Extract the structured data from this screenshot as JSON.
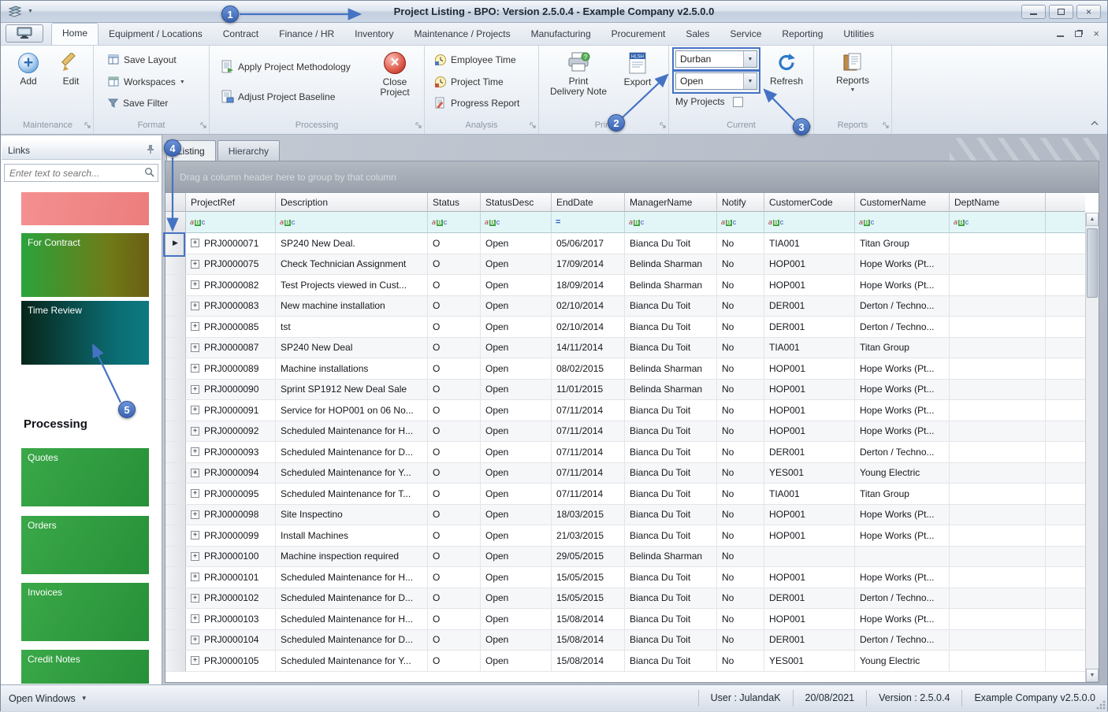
{
  "titlebar": {
    "screen_title": "Project Listing",
    "app_title": " - BPO: Version 2.5.0.4 - Example Company v2.5.0.0"
  },
  "icons": {
    "close": "×",
    "dropdown_caret": "▼",
    "scroll_up": "▲",
    "scroll_down": "▼",
    "expand_plus": "+",
    "row_indicator": "▶",
    "filter_abc": "aBc",
    "filter_equals": "=",
    "export_badge": "HLSH"
  },
  "ribbon": {
    "active_tab": "Home",
    "tabs": [
      "Home",
      "Equipment / Locations",
      "Contract",
      "Finance / HR",
      "Inventory",
      "Maintenance / Projects",
      "Manufacturing",
      "Procurement",
      "Sales",
      "Service",
      "Reporting",
      "Utilities"
    ],
    "maintenance": {
      "label": "Maintenance",
      "add": "Add",
      "edit": "Edit"
    },
    "format": {
      "label": "Format",
      "save_layout": "Save Layout",
      "workspaces": "Workspaces",
      "save_filter": "Save Filter"
    },
    "processing": {
      "label": "Processing",
      "apply": "Apply Project Methodology",
      "adjust": "Adjust Project Baseline",
      "close_line1": "Close",
      "close_line2": "Project"
    },
    "analysis": {
      "label": "Analysis",
      "employee_time": "Employee Time",
      "project_time": "Project Time",
      "progress_report": "Progress Report"
    },
    "print": {
      "label": "Print",
      "delivery_line1": "Print",
      "delivery_line2": "Delivery Note",
      "export": "Export"
    },
    "current": {
      "label": "Current",
      "site": "Durban",
      "status": "Open",
      "my_projects": "My Projects",
      "refresh": "Refresh"
    },
    "reports": {
      "label": "Reports",
      "button": "Reports"
    }
  },
  "sidebar": {
    "header": "Links",
    "search_placeholder": "Enter text to search...",
    "links": [
      {
        "label": ""
      },
      {
        "label": "For Contract"
      },
      {
        "label": "Time Review"
      }
    ],
    "section_header": "Processing",
    "processing_links": [
      "Quotes",
      "Orders",
      "Invoices",
      "Credit Notes"
    ]
  },
  "workspace": {
    "active_tab": "Listing",
    "tabs": [
      "Listing",
      "Hierarchy"
    ],
    "group_panel_hint": "Drag a column header here to group by that column"
  },
  "grid": {
    "columns": [
      "ProjectRef",
      "Description",
      "Status",
      "StatusDesc",
      "EndDate",
      "ManagerName",
      "Notify",
      "CustomerCode",
      "CustomerName",
      "DeptName"
    ],
    "filter_types": [
      "abc",
      "abc",
      "abc",
      "abc",
      "eq",
      "abc",
      "abc",
      "abc",
      "abc",
      "abc"
    ],
    "rows": [
      [
        "PRJ0000071",
        "SP240 New Deal.",
        "O",
        "Open",
        "05/06/2017",
        "Bianca Du Toit",
        "No",
        "TIA001",
        "Titan Group",
        ""
      ],
      [
        "PRJ0000075",
        "Check Technician Assignment",
        "O",
        "Open",
        "17/09/2014",
        "Belinda Sharman",
        "No",
        "HOP001",
        "Hope Works (Pt...",
        ""
      ],
      [
        "PRJ0000082",
        "Test Projects viewed in Cust...",
        "O",
        "Open",
        "18/09/2014",
        "Belinda Sharman",
        "No",
        "HOP001",
        "Hope Works (Pt...",
        ""
      ],
      [
        "PRJ0000083",
        "New machine installation",
        "O",
        "Open",
        "02/10/2014",
        "Bianca Du Toit",
        "No",
        "DER001",
        "Derton / Techno...",
        ""
      ],
      [
        "PRJ0000085",
        "tst",
        "O",
        "Open",
        "02/10/2014",
        "Bianca Du Toit",
        "No",
        "DER001",
        "Derton / Techno...",
        ""
      ],
      [
        "PRJ0000087",
        "SP240 New Deal",
        "O",
        "Open",
        "14/11/2014",
        "Bianca Du Toit",
        "No",
        "TIA001",
        "Titan Group",
        ""
      ],
      [
        "PRJ0000089",
        "Machine installations",
        "O",
        "Open",
        "08/02/2015",
        "Belinda Sharman",
        "No",
        "HOP001",
        "Hope Works (Pt...",
        ""
      ],
      [
        "PRJ0000090",
        "Sprint SP1912 New Deal Sale",
        "O",
        "Open",
        "11/01/2015",
        "Belinda Sharman",
        "No",
        "HOP001",
        "Hope Works (Pt...",
        ""
      ],
      [
        "PRJ0000091",
        "Service for HOP001 on 06 No...",
        "O",
        "Open",
        "07/11/2014",
        "Bianca Du Toit",
        "No",
        "HOP001",
        "Hope Works (Pt...",
        ""
      ],
      [
        "PRJ0000092",
        "Scheduled Maintenance for H...",
        "O",
        "Open",
        "07/11/2014",
        "Bianca Du Toit",
        "No",
        "HOP001",
        "Hope Works (Pt...",
        ""
      ],
      [
        "PRJ0000093",
        "Scheduled Maintenance for D...",
        "O",
        "Open",
        "07/11/2014",
        "Bianca Du Toit",
        "No",
        "DER001",
        "Derton / Techno...",
        ""
      ],
      [
        "PRJ0000094",
        "Scheduled Maintenance for Y...",
        "O",
        "Open",
        "07/11/2014",
        "Bianca Du Toit",
        "No",
        "YES001",
        "Young Electric",
        ""
      ],
      [
        "PRJ0000095",
        "Scheduled Maintenance for T...",
        "O",
        "Open",
        "07/11/2014",
        "Bianca Du Toit",
        "No",
        "TIA001",
        "Titan Group",
        ""
      ],
      [
        "PRJ0000098",
        "Site Inspectino",
        "O",
        "Open",
        "18/03/2015",
        "Bianca Du Toit",
        "No",
        "HOP001",
        "Hope Works (Pt...",
        ""
      ],
      [
        "PRJ0000099",
        "Install Machines",
        "O",
        "Open",
        "21/03/2015",
        "Bianca Du Toit",
        "No",
        "HOP001",
        "Hope Works (Pt...",
        ""
      ],
      [
        "PRJ0000100",
        "Machine inspection required",
        "O",
        "Open",
        "29/05/2015",
        "Belinda Sharman",
        "No",
        "",
        "",
        ""
      ],
      [
        "PRJ0000101",
        "Scheduled Maintenance for H...",
        "O",
        "Open",
        "15/05/2015",
        "Bianca Du Toit",
        "No",
        "HOP001",
        "Hope Works (Pt...",
        ""
      ],
      [
        "PRJ0000102",
        "Scheduled Maintenance for D...",
        "O",
        "Open",
        "15/05/2015",
        "Bianca Du Toit",
        "No",
        "DER001",
        "Derton / Techno...",
        ""
      ],
      [
        "PRJ0000103",
        "Scheduled Maintenance for H...",
        "O",
        "Open",
        "15/08/2014",
        "Bianca Du Toit",
        "No",
        "HOP001",
        "Hope Works (Pt...",
        ""
      ],
      [
        "PRJ0000104",
        "Scheduled Maintenance for D...",
        "O",
        "Open",
        "15/08/2014",
        "Bianca Du Toit",
        "No",
        "DER001",
        "Derton / Techno...",
        ""
      ],
      [
        "PRJ0000105",
        "Scheduled Maintenance for Y...",
        "O",
        "Open",
        "15/08/2014",
        "Bianca Du Toit",
        "No",
        "YES001",
        "Young Electric",
        ""
      ]
    ]
  },
  "statusbar": {
    "open_windows": "Open Windows",
    "user": "User : JulandaK",
    "date": "20/08/2021",
    "version": "Version : 2.5.0.4",
    "company": "Example Company v2.5.0.0"
  },
  "annotations": {
    "accent_color": "#4573c4",
    "steps": [
      "1",
      "2",
      "3",
      "4",
      "5"
    ]
  }
}
